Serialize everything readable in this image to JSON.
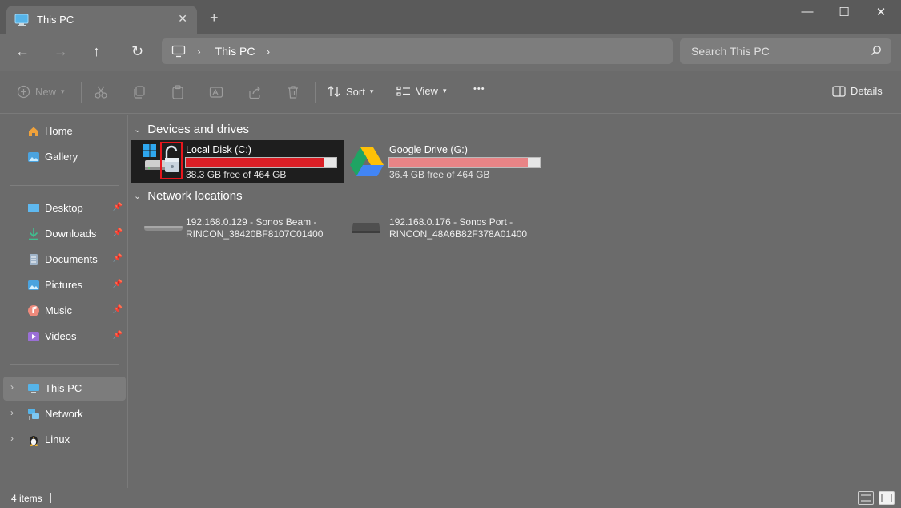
{
  "window": {
    "tab_title": "This PC",
    "tab_close": "✕",
    "new_tab": "+",
    "minimize": "—",
    "maximize": "☐",
    "close": "✕"
  },
  "nav": {
    "back": "←",
    "forward": "→",
    "up": "↑",
    "refresh": "↻",
    "crumb": "This PC",
    "crumb_sep": "›",
    "search_placeholder": "Search This PC"
  },
  "toolbar": {
    "new_label": "New",
    "sort_label": "Sort",
    "view_label": "View",
    "more": "•••",
    "details_label": "Details"
  },
  "sidebar": {
    "quick": [
      {
        "label": "Home",
        "icon": "home-icon",
        "pinned": false
      },
      {
        "label": "Gallery",
        "icon": "gallery-icon",
        "pinned": false
      }
    ],
    "pinned": [
      {
        "label": "Desktop",
        "icon": "desktop-icon"
      },
      {
        "label": "Downloads",
        "icon": "downloads-icon"
      },
      {
        "label": "Documents",
        "icon": "documents-icon"
      },
      {
        "label": "Pictures",
        "icon": "pictures-icon"
      },
      {
        "label": "Music",
        "icon": "music-icon"
      },
      {
        "label": "Videos",
        "icon": "videos-icon"
      }
    ],
    "tree": [
      {
        "label": "This PC",
        "icon": "this-pc-icon",
        "selected": true
      },
      {
        "label": "Network",
        "icon": "network-icon",
        "selected": false
      },
      {
        "label": "Linux",
        "icon": "linux-icon",
        "selected": false
      }
    ]
  },
  "content": {
    "devices_header": "Devices and drives",
    "network_header": "Network locations",
    "drives": [
      {
        "name": "Local Disk (C:)",
        "free": "38.3 GB free of 464 GB",
        "used_fraction": 0.917,
        "bar_color": "#da1f26",
        "selected": true
      },
      {
        "name": "Google Drive (G:)",
        "free": "36.4 GB free of 464 GB",
        "used_fraction": 0.922,
        "bar_color": "#e88486",
        "selected": false
      }
    ],
    "network": [
      {
        "line1": "192.168.0.129 - Sonos Beam -",
        "line2": "RINCON_38420BF8107C01400"
      },
      {
        "line1": "192.168.0.176 - Sonos Port -",
        "line2": "RINCON_48A6B82F378A01400"
      }
    ]
  },
  "status": {
    "items": "4 items"
  },
  "colors": {
    "background": "#6b6b6b",
    "titlebar": "#5a5a5a",
    "selected_drive": "#1e1e1e",
    "lock_highlight": "#e8161c"
  }
}
